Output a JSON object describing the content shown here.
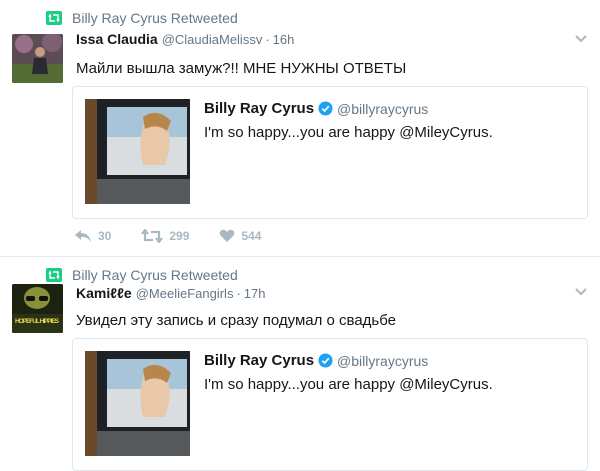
{
  "tweets": [
    {
      "retweeted_by": "Billy Ray Cyrus Retweeted",
      "name": "Issa Claudia",
      "handle": "@ClaudiaMelissv",
      "dot": "·",
      "time": "16h",
      "text": "Майли вышла замуж?!! МНЕ НУЖНЫ ОТВЕТЫ",
      "quote": {
        "name": "Billy Ray Cyrus",
        "handle": "@billyraycyrus",
        "text": "I'm so happy...you are happy @MileyCyrus."
      },
      "actions": {
        "reply_count": "30",
        "retweet_count": "299",
        "like_count": "544"
      }
    },
    {
      "retweeted_by": "Billy Ray Cyrus Retweeted",
      "name": "Kamiℓℓe",
      "handle": "@MeelieFangirls",
      "dot": "·",
      "time": "17h",
      "text": "Увидел эту запись и сразу подумал о свадьбе",
      "avatar_text": "HOPEFUL HIPPIES",
      "quote": {
        "name": "Billy Ray Cyrus",
        "handle": "@billyraycyrus",
        "text": "I'm so happy...you are happy @MileyCyrus."
      }
    }
  ],
  "colors": {
    "retweet_green": "#19cf86",
    "verified_blue": "#1da1f2",
    "muted": "#657786",
    "action_gray": "#aab8c2"
  },
  "icons": {
    "retweet": "retweet-icon",
    "reply": "reply-icon",
    "like": "heart-icon",
    "verified": "verified-badge-icon",
    "caret": "chevron-down-icon"
  }
}
